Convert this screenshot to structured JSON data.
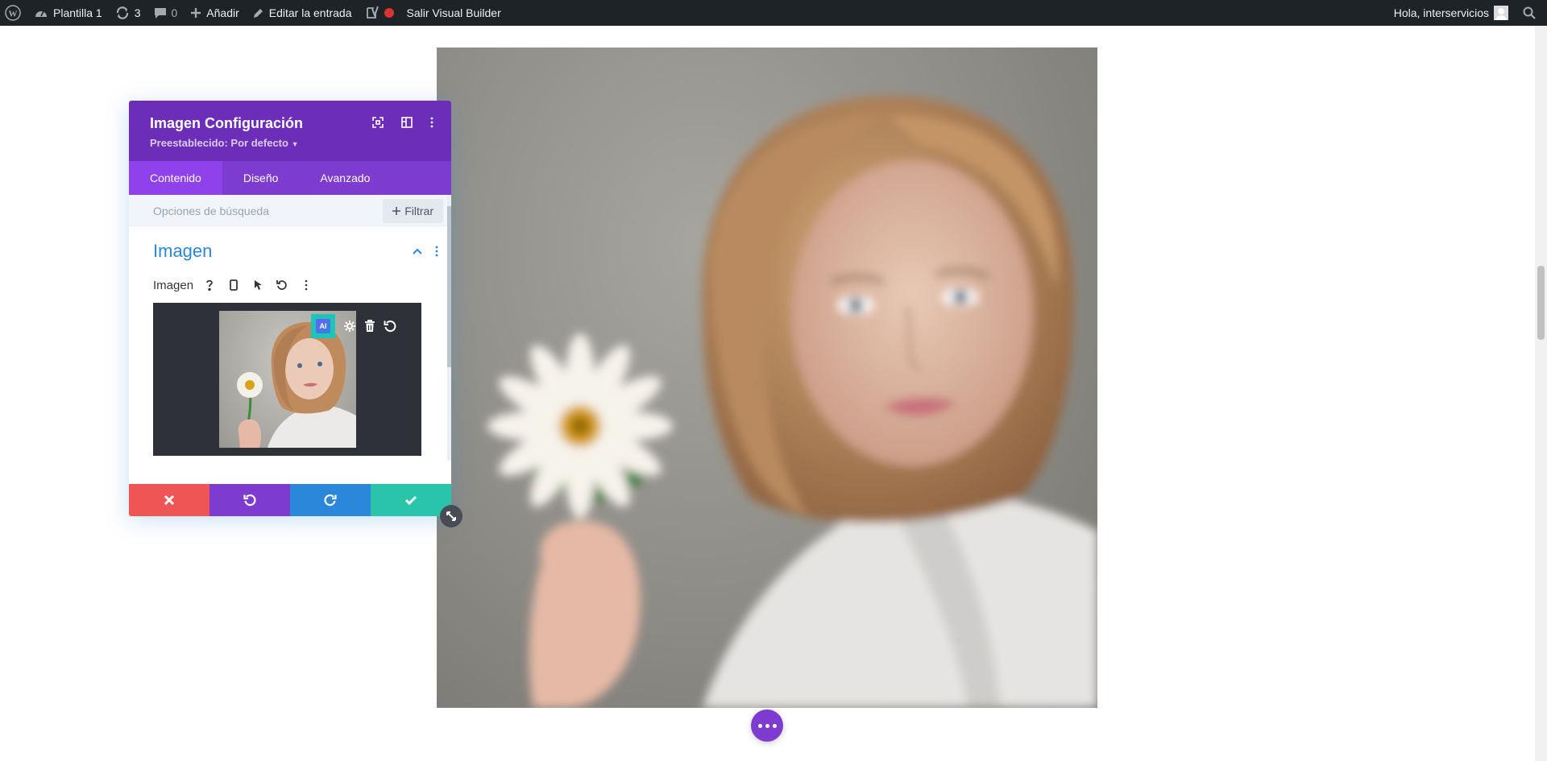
{
  "admin_bar": {
    "site_name": "Plantilla 1",
    "updates_count": "3",
    "comments_count": "0",
    "add_label": "Añadir",
    "edit_label": "Editar la entrada",
    "exit_label": "Salir Visual Builder",
    "greeting": "Hola, interservicios"
  },
  "panel": {
    "title": "Imagen Configuración",
    "preset": "Preestablecido: Por defecto",
    "tabs": [
      {
        "label": "Contenido",
        "active": true
      },
      {
        "label": "Diseño",
        "active": false
      },
      {
        "label": "Avanzado",
        "active": false
      }
    ],
    "search_placeholder": "Opciones de búsqueda",
    "filter_label": "Filtrar",
    "section_title": "Imagen",
    "field_label": "Imagen",
    "ai_label": "AI"
  },
  "colors": {
    "panel_header": "#6c2eb9",
    "tabs_bg": "#7d3bcf",
    "tab_active": "#8f42ec",
    "cancel": "#ef5555",
    "undo": "#7e3bd0",
    "redo": "#2b87da",
    "save": "#29c4a9",
    "ai_button": "#20c3b8"
  }
}
